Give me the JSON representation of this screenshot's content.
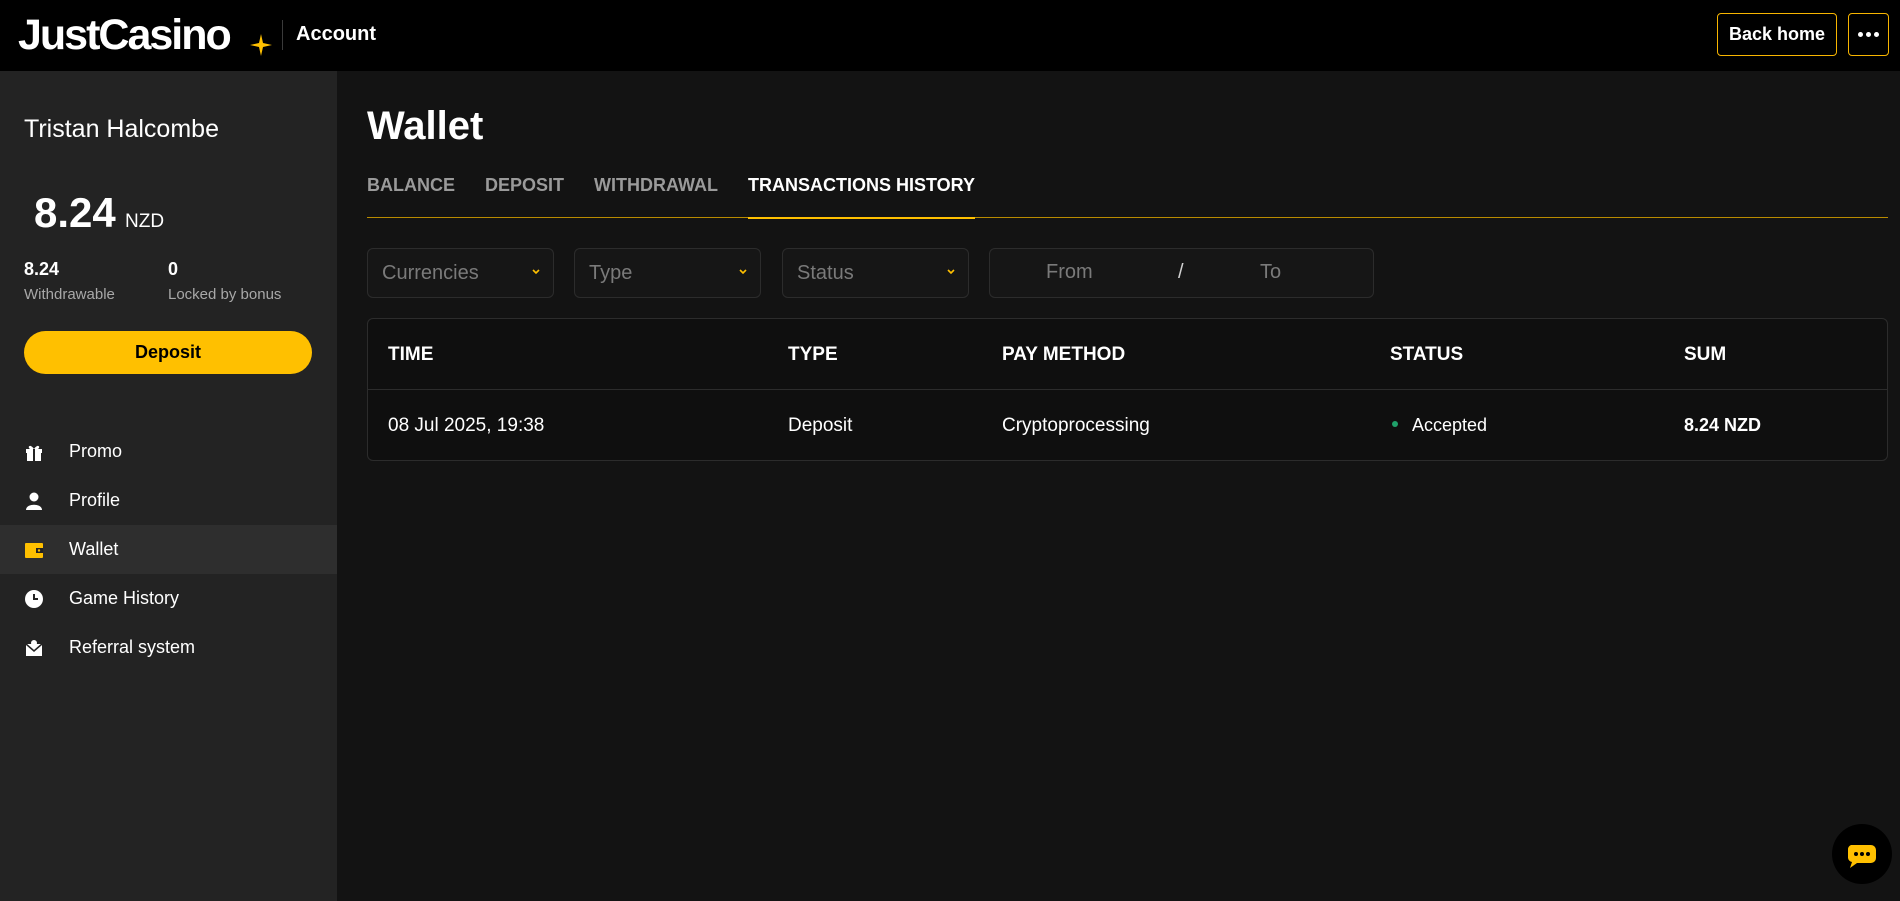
{
  "header": {
    "logo_text": "JustCasino",
    "title": "Account",
    "back_home_label": "Back home",
    "more_icon": "ellipsis-icon"
  },
  "sidebar": {
    "user_name": "Tristan Halcombe",
    "balance": "8.24",
    "currency": "NZD",
    "withdrawable_value": "8.24",
    "withdrawable_label": "Withdrawable",
    "locked_value": "0",
    "locked_label": "Locked by bonus",
    "deposit_label": "Deposit",
    "nav": [
      {
        "label": "Promo",
        "icon": "gift-icon"
      },
      {
        "label": "Profile",
        "icon": "user-icon"
      },
      {
        "label": "Wallet",
        "icon": "wallet-icon",
        "active": true
      },
      {
        "label": "Game History",
        "icon": "clock-icon"
      },
      {
        "label": "Referral system",
        "icon": "envelope-icon"
      }
    ]
  },
  "main": {
    "title": "Wallet",
    "tabs": [
      {
        "label": "BALANCE"
      },
      {
        "label": "DEPOSIT"
      },
      {
        "label": "WITHDRAWAL"
      },
      {
        "label": "TRANSACTIONS HISTORY",
        "active": true
      }
    ],
    "filters": {
      "currencies": "Currencies",
      "type": "Type",
      "status": "Status",
      "date_from": "From",
      "date_separator": "/",
      "date_to": "To"
    },
    "table": {
      "columns": [
        "TIME",
        "TYPE",
        "PAY METHOD",
        "STATUS",
        "SUM"
      ],
      "rows": [
        {
          "time": "08 Jul 2025, 19:38",
          "type": "Deposit",
          "pay_method": "Cryptoprocessing",
          "status": "Accepted",
          "sum": "8.24 NZD"
        }
      ]
    }
  },
  "colors": {
    "accent": "#ffc000",
    "status_accepted": "#1fa16a",
    "header_bg": "#000000",
    "sidebar_bg": "#232323",
    "main_bg": "#131313"
  }
}
